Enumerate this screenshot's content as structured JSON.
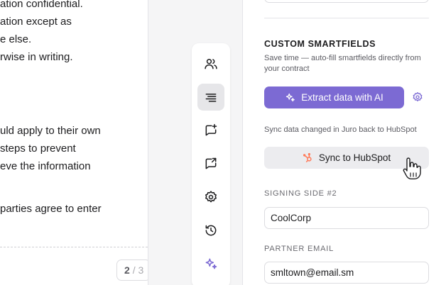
{
  "document": {
    "lines": [
      "ation confidential.",
      "ation except as",
      "e else.",
      "rwise in writing.",
      "uld apply to their own",
      "steps to prevent",
      "eve the information",
      "parties agree to enter"
    ],
    "page_current": "2",
    "page_separator": "/",
    "page_total": "3"
  },
  "toolbar": {
    "tools": [
      {
        "icon": "users-icon"
      },
      {
        "icon": "text-align-icon"
      },
      {
        "icon": "add-comment-icon"
      },
      {
        "icon": "share-icon"
      },
      {
        "icon": "gear-icon"
      },
      {
        "icon": "history-icon"
      },
      {
        "icon": "ai-sparkle-icon"
      }
    ]
  },
  "panel": {
    "section_title": "CUSTOM SMARTFIELDS",
    "section_desc": "Save time — auto-fill smartfields directly from your contract",
    "extract_label": "Extract data with AI",
    "sync_note": "Sync data changed in Juro back to HubSpot",
    "sync_label": "Sync to HubSpot",
    "fields": [
      {
        "label": "SIGNING SIDE #2",
        "value": "CoolCorp"
      },
      {
        "label": "PARTNER EMAIL",
        "value": "smltown@email.sm"
      }
    ]
  },
  "colors": {
    "accent": "#7c6ad3",
    "hubspot": "#ff7a59"
  }
}
